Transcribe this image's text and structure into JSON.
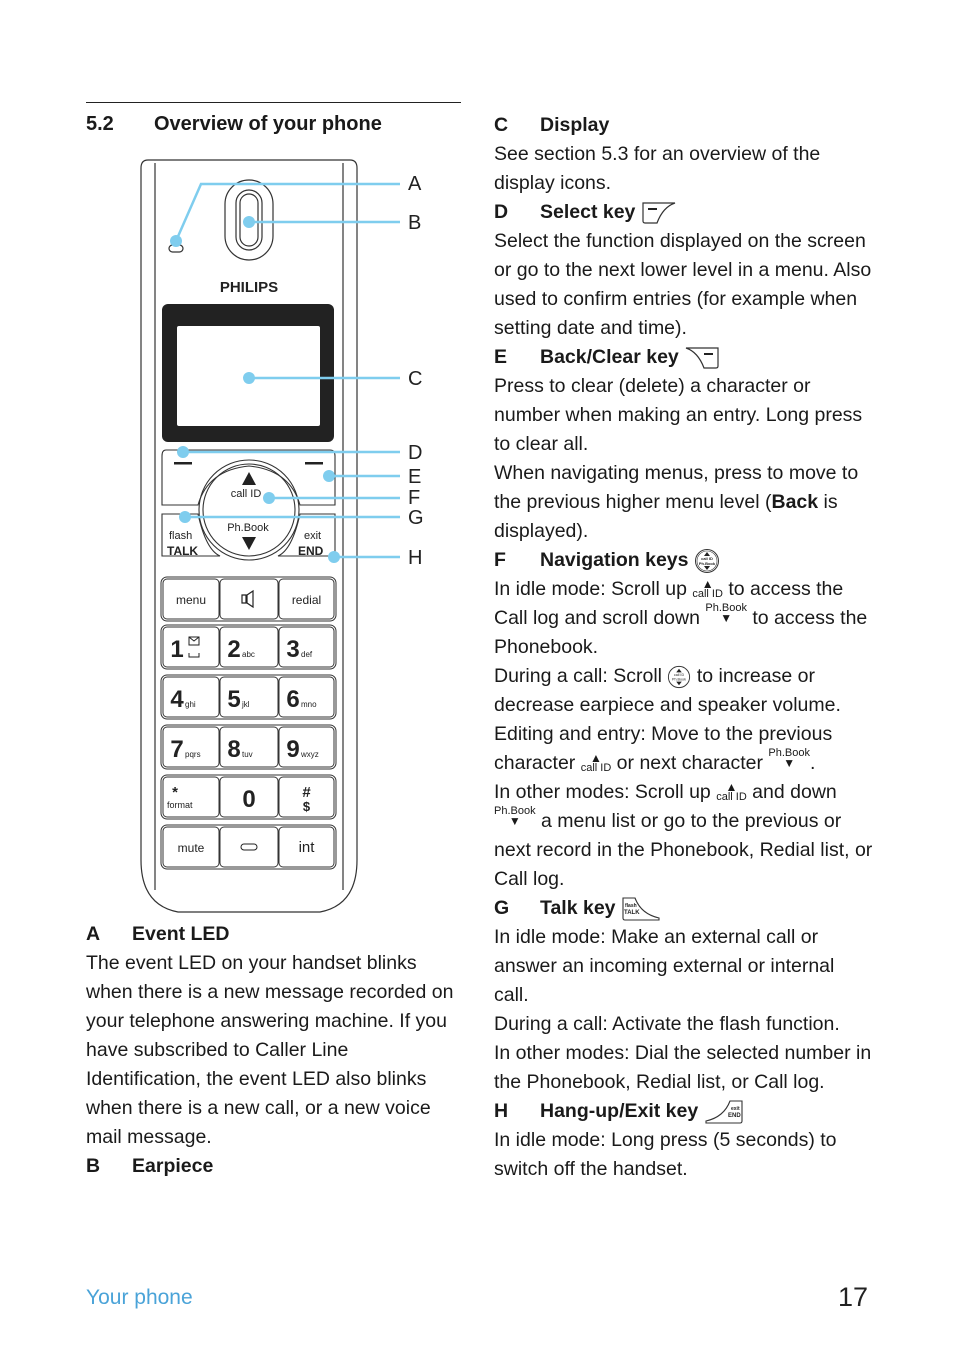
{
  "section": {
    "number": "5.2",
    "title": "Overview of your phone"
  },
  "phone": {
    "brand": "PHILIPS",
    "callouts": [
      "A",
      "B",
      "C",
      "D",
      "E",
      "F",
      "G",
      "H"
    ],
    "callout_color": "#7fcdee",
    "nav": {
      "up": "call ID",
      "down": "Ph.Book"
    },
    "talk": {
      "top": "flash",
      "main": "TALK"
    },
    "end": {
      "top": "exit",
      "main": "END"
    },
    "func_row": [
      "menu",
      "speaker",
      "redial"
    ],
    "keys": [
      {
        "d": "1",
        "s": "voicemail"
      },
      {
        "d": "2",
        "s": "abc"
      },
      {
        "d": "3",
        "s": "def"
      },
      {
        "d": "4",
        "s": "ghi"
      },
      {
        "d": "5",
        "s": "jkl"
      },
      {
        "d": "6",
        "s": "mno"
      },
      {
        "d": "7",
        "s": "pqrs"
      },
      {
        "d": "8",
        "s": "tuv"
      },
      {
        "d": "9",
        "s": "wxyz"
      },
      {
        "d": "*",
        "s": "format"
      },
      {
        "d": "0",
        "s": ""
      },
      {
        "d": "#",
        "s": "pause"
      }
    ],
    "bottom_row": [
      "mute",
      "intercom-key",
      "int"
    ]
  },
  "left_col": {
    "a_letter": "A",
    "a_title": "Event LED",
    "a_text": "The event LED on your handset blinks when there is a new message recorded on your telephone answering machine. If you have subscribed to Caller Line Identification, the event LED also blinks when there is a new call, or a new voice mail message.",
    "b_letter": "B",
    "b_title": "Earpiece"
  },
  "right_col": {
    "c_letter": "C",
    "c_title": "Display",
    "c_text": "See section 5.3 for an overview of the display icons.",
    "d_letter": "D",
    "d_title": "Select key",
    "d_text": "Select the function displayed on the screen or go to the next lower level in a menu. Also used to confirm entries (for example when setting date and time).",
    "e_letter": "E",
    "e_title": "Back/Clear key",
    "e_text1": "Press to clear (delete) a character or number when making an entry. Long press to clear all.",
    "e_text2a": "When navigating menus, press to move to the previous higher menu level (",
    "e_text2b": "Back",
    "e_text2c": " is displayed).",
    "f_letter": "F",
    "f_title": "Navigation keys",
    "f_idle_a": "In idle mode: Scroll up ",
    "f_idle_b": " to access the Call log and scroll down ",
    "f_idle_c": " to access the Phonebook.",
    "f_call_a": "During a call: Scroll ",
    "f_call_b": " to increase or decrease earpiece and speaker volume.",
    "f_edit_a": "Editing and entry: Move to the previous character ",
    "f_edit_b": " or next character ",
    "f_edit_c": ".",
    "f_other_a": "In other modes: Scroll up ",
    "f_other_b": " and down ",
    "f_other_c": " a menu list or go to the previous or next record in the Phonebook, Redial list, or Call log.",
    "g_letter": "G",
    "g_title": "Talk key",
    "g_text1": "In idle mode: Make an external call or answer an incoming external or internal call.",
    "g_text2": "During a call: Activate the flash function.",
    "g_text3": "In other modes: Dial the selected number in the Phonebook, Redial list, or Call log.",
    "h_letter": "H",
    "h_title": "Hang-up/Exit key",
    "h_text": "In idle mode: Long press (5 seconds) to switch off the handset."
  },
  "inline_labels": {
    "call_id": "call ID",
    "ph_book": "Ph.Book"
  },
  "footer": {
    "section_name": "Your phone",
    "page_number": "17"
  }
}
